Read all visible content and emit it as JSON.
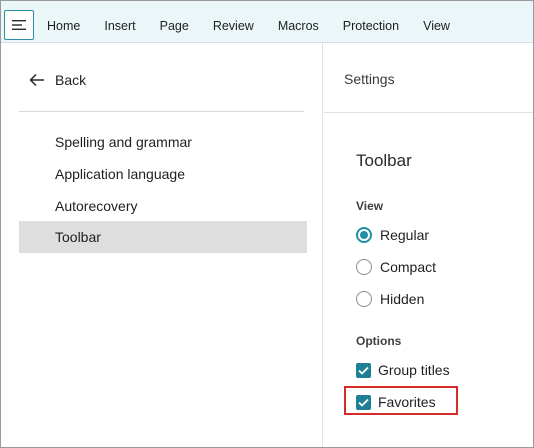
{
  "ribbon": {
    "menu_icon": "hamburger-icon",
    "tabs": [
      "Home",
      "Insert",
      "Page",
      "Review",
      "Macros",
      "Protection",
      "View"
    ]
  },
  "nav": {
    "back_label": "Back",
    "back_icon": "arrow-left-icon",
    "items": [
      {
        "label": "Spelling and grammar",
        "selected": false
      },
      {
        "label": "Application language",
        "selected": false
      },
      {
        "label": "Autorecovery",
        "selected": false
      },
      {
        "label": "Toolbar",
        "selected": true
      }
    ]
  },
  "settings": {
    "header": "Settings",
    "section_title": "Toolbar",
    "view": {
      "label": "View",
      "options": [
        {
          "label": "Regular",
          "selected": true
        },
        {
          "label": "Compact",
          "selected": false
        },
        {
          "label": "Hidden",
          "selected": false
        }
      ]
    },
    "options": {
      "label": "Options",
      "items": [
        {
          "label": "Group titles",
          "checked": true
        },
        {
          "label": "Favorites",
          "checked": true,
          "highlighted": true
        }
      ]
    }
  },
  "colors": {
    "accent": "#1f8fa5",
    "ribbon_bg": "#eaf6f8",
    "selected_bg": "#dedede",
    "highlight_border": "#d62b2b"
  }
}
